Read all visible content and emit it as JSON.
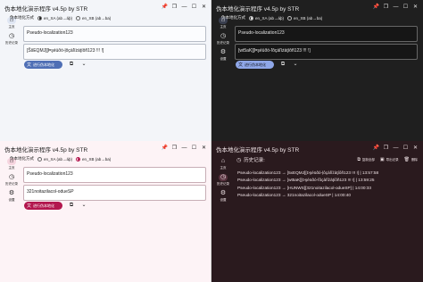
{
  "app": {
    "title": "伪本地化演示程序 v4.5p by STR",
    "controls": {
      "pin": "📌",
      "restore": "❐",
      "minimize": "—",
      "maximize": "☐",
      "close": "✕"
    }
  },
  "nav": {
    "home_label": "主页",
    "history_label": "历史记录",
    "settings_label": "设置"
  },
  "mode": {
    "label": "伪本地化方式",
    "option1": "en_XA (ab→áþ)",
    "option2": "en_XB (ab→ba)"
  },
  "windows": {
    "light_blue": {
      "input_value": "Pseudo-localization123",
      "output_value": "[ŠšEQMJ][Þşéüðó-ļôçàľíżàţíôñ123 !!! !]",
      "selected_option": 1
    },
    "dark_blue": {
      "input_value": "Pseudo-localization123",
      "output_value": "[wt5aK][Þşéüðó-ľôçáľíżàţíôñ123 !!! !]",
      "selected_option": 1
    },
    "light_pink": {
      "input_value": "Pseudo-localization123",
      "output_value": "321noitazilacol-odueSP",
      "selected_option": 2
    }
  },
  "actions": {
    "primary_label": "进行伪本地化",
    "copy_icon": "⧉",
    "more_icon": "⌄"
  },
  "history": {
    "title": "历史记录:",
    "export_label": "导出记录",
    "copy_all_label": "复制全部",
    "clear_label": "删除",
    "items": [
      "Pseudo-localization123 → [5xEQMJ][Þşéüðó-ļôçàľíżàţíôñ123 !!! !] | 13:57:58",
      "Pseudo-localization123 → [wt5aK][Þşéüðó-ľôçàľíżàţíôñ123 !!! !] | 13:59:25",
      "Pseudo-localization123 → [HUNWS][321noitazilacol-odueSP] | 14:00:33",
      "Pseudo-localization123 → 321noitazilacol-odueSP | 14:00:40"
    ]
  },
  "colors": {
    "blue_accent": "#4f6fb5",
    "dark_accent": "#8fa7e8",
    "pink_accent": "#b3174e",
    "dark_bg": "#1f1f1f",
    "wine_bg": "#2a1a1e"
  }
}
